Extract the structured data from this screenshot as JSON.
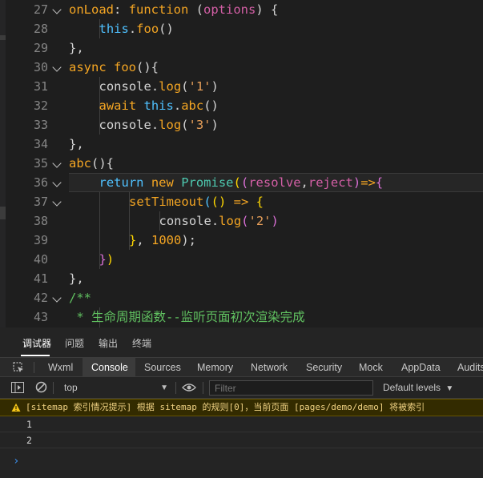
{
  "editor": {
    "lines": [
      {
        "n": "27",
        "fold": true,
        "indent": 1,
        "tokens": [
          [
            "onLoad",
            "fn"
          ],
          [
            ": ",
            "pu"
          ],
          [
            "function",
            "kw"
          ],
          [
            " ",
            "pu"
          ],
          [
            "(",
            "pu"
          ],
          [
            "options",
            "prm"
          ],
          [
            ")",
            "pu"
          ],
          [
            " {",
            "pu"
          ]
        ]
      },
      {
        "n": "28",
        "fold": false,
        "indent": 2,
        "tokens": [
          [
            "this",
            "kwb"
          ],
          [
            ".",
            "pu"
          ],
          [
            "foo",
            "fn"
          ],
          [
            "()",
            "pu"
          ]
        ]
      },
      {
        "n": "29",
        "fold": false,
        "indent": 1,
        "tokens": [
          [
            "},",
            "pu"
          ]
        ]
      },
      {
        "n": "30",
        "fold": true,
        "indent": 1,
        "tokens": [
          [
            "async",
            "kw"
          ],
          [
            " ",
            "pu"
          ],
          [
            "foo",
            "fn"
          ],
          [
            "(){",
            "pu"
          ]
        ]
      },
      {
        "n": "31",
        "fold": false,
        "indent": 2,
        "tokens": [
          [
            "console",
            "pu"
          ],
          [
            ".",
            "pu"
          ],
          [
            "log",
            "fn"
          ],
          [
            "(",
            "pu"
          ],
          [
            "'1'",
            "str"
          ],
          [
            ")",
            "pu"
          ]
        ]
      },
      {
        "n": "32",
        "fold": false,
        "indent": 2,
        "tokens": [
          [
            "await",
            "kw"
          ],
          [
            " ",
            "pu"
          ],
          [
            "this",
            "kwb"
          ],
          [
            ".",
            "pu"
          ],
          [
            "abc",
            "fn"
          ],
          [
            "()",
            "pu"
          ]
        ]
      },
      {
        "n": "33",
        "fold": false,
        "indent": 2,
        "tokens": [
          [
            "console",
            "pu"
          ],
          [
            ".",
            "pu"
          ],
          [
            "log",
            "fn"
          ],
          [
            "(",
            "pu"
          ],
          [
            "'3'",
            "str"
          ],
          [
            ")",
            "pu"
          ]
        ]
      },
      {
        "n": "34",
        "fold": false,
        "indent": 1,
        "tokens": [
          [
            "},",
            "pu"
          ]
        ]
      },
      {
        "n": "35",
        "fold": true,
        "indent": 1,
        "tokens": [
          [
            "abc",
            "fn"
          ],
          [
            "(){",
            "pu"
          ]
        ]
      },
      {
        "n": "36",
        "fold": true,
        "indent": 2,
        "active": true,
        "tokens": [
          [
            "return",
            "kwb"
          ],
          [
            " ",
            "pu"
          ],
          [
            "new",
            "kw"
          ],
          [
            " ",
            "pu"
          ],
          [
            "Promise",
            "cls"
          ],
          [
            "(",
            "bk1"
          ],
          [
            "(",
            "bk2"
          ],
          [
            "resolve",
            "prm"
          ],
          [
            ",",
            "pu"
          ],
          [
            "reject",
            "prm"
          ],
          [
            ")",
            "bk2"
          ],
          [
            "=>",
            "kw"
          ],
          [
            "{",
            "bk2"
          ]
        ]
      },
      {
        "n": "37",
        "fold": true,
        "indent": 3,
        "tokens": [
          [
            "setTimeout",
            "fn"
          ],
          [
            "(",
            "bk3"
          ],
          [
            "()",
            "bk1"
          ],
          [
            " => ",
            "kw"
          ],
          [
            "{",
            "bk1"
          ]
        ]
      },
      {
        "n": "38",
        "fold": false,
        "indent": 4,
        "tokens": [
          [
            "console",
            "pu"
          ],
          [
            ".",
            "pu"
          ],
          [
            "log",
            "fn"
          ],
          [
            "(",
            "bk2"
          ],
          [
            "'2'",
            "str"
          ],
          [
            ")",
            "bk2"
          ]
        ]
      },
      {
        "n": "39",
        "fold": false,
        "indent": 3,
        "tokens": [
          [
            "}",
            "bk1"
          ],
          [
            ", ",
            "pu"
          ],
          [
            "1000",
            "num"
          ],
          [
            ");",
            "pu"
          ]
        ]
      },
      {
        "n": "40",
        "fold": false,
        "indent": 2,
        "tokens": [
          [
            "}",
            "bk2"
          ],
          [
            ")",
            "bk1"
          ]
        ]
      },
      {
        "n": "41",
        "fold": false,
        "indent": 1,
        "tokens": [
          [
            "},",
            "pu"
          ]
        ]
      },
      {
        "n": "42",
        "fold": true,
        "indent": 1,
        "tokens": [
          [
            "/**",
            "cm"
          ]
        ]
      },
      {
        "n": "43",
        "fold": false,
        "indent": 1,
        "tokens": [
          [
            " * 生命周期函数--监听页面初次渲染完成",
            "cm"
          ]
        ]
      }
    ]
  },
  "devtools": {
    "top_tabs": [
      "调试器",
      "问题",
      "输出",
      "终端"
    ],
    "panel_tabs": [
      "Wxml",
      "Console",
      "Sources",
      "Memory",
      "Network",
      "Security",
      "Mock",
      "AppData",
      "Audits"
    ],
    "context": "top",
    "filter_placeholder": "Filter",
    "levels_label": "Default levels",
    "warning": "[sitemap 索引情况提示] 根据 sitemap 的规则[0]，当前页面 [pages/demo/demo] 将被索引",
    "logs": [
      "1",
      "2"
    ],
    "prompt": "›"
  }
}
